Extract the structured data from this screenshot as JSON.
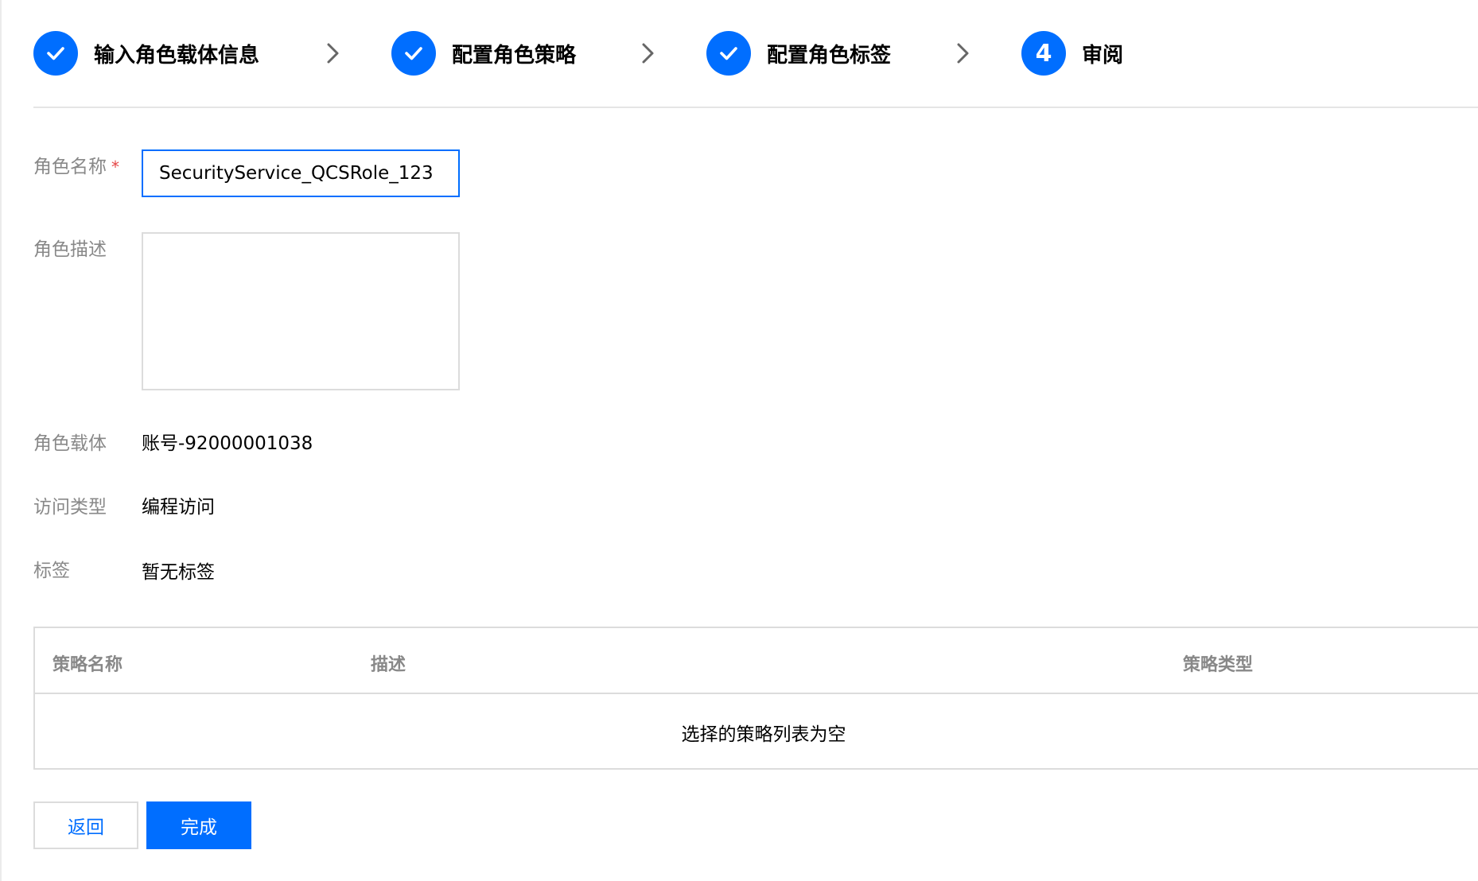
{
  "stepper": {
    "steps": [
      {
        "label": "输入角色载体信息",
        "state": "done",
        "icon": "check-icon"
      },
      {
        "label": "配置角色策略",
        "state": "done",
        "icon": "check-icon"
      },
      {
        "label": "配置角色标签",
        "state": "done",
        "icon": "check-icon"
      },
      {
        "label": "审阅",
        "state": "active",
        "number": "4"
      }
    ],
    "separator_icon": "chevron-right-icon"
  },
  "form": {
    "role_name": {
      "label": "角色名称",
      "required_mark": "*",
      "value": "SecurityService_QCSRole_123"
    },
    "role_description": {
      "label": "角色描述",
      "value": ""
    },
    "role_carrier": {
      "label": "角色载体",
      "value": "账号-92000001038"
    },
    "access_type": {
      "label": "访问类型",
      "value": "编程访问"
    },
    "tags": {
      "label": "标签",
      "value": "暂无标签"
    }
  },
  "policy_table": {
    "columns": [
      "策略名称",
      "描述",
      "策略类型"
    ],
    "rows": [],
    "empty_text": "选择的策略列表为空"
  },
  "actions": {
    "back_label": "返回",
    "done_label": "完成"
  },
  "colors": {
    "primary": "#006eff",
    "label_gray": "#888888",
    "border": "#dcdcdc",
    "required": "#e54545"
  }
}
